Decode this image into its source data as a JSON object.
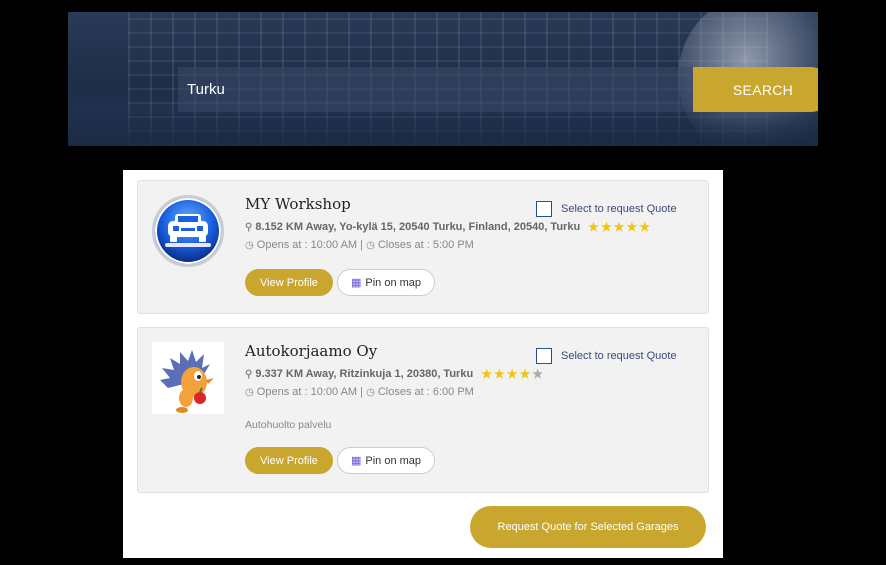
{
  "search": {
    "value": "Turku",
    "button_label": "SEARCH"
  },
  "colors": {
    "accent": "#c9a62e",
    "star": "#f1c40f",
    "map_icon": "#6c4fd6"
  },
  "garages": [
    {
      "name": "MY Workshop",
      "address": "8.152 KM Away, Yo-kylä 15, 20540 Turku, Finland, 20540, Turku",
      "rating": 5,
      "opens": "Opens at : 10:00 AM |",
      "closes": "Closes at : 5:00 PM",
      "description": "",
      "logo_icon": "car-wrench-logo-icon",
      "view_label": "View Profile",
      "map_label": "Pin on map",
      "quote_label": "Select to request Quote"
    },
    {
      "name": "Autokorjaamo Oy",
      "address": "9.337 KM Away, Ritzinkuja 1, 20380, Turku",
      "rating": 4,
      "opens": "Opens at : 10:00 AM |",
      "closes": "Closes at : 6:00 PM",
      "description": "Autohuolto palvelu",
      "logo_icon": "hedgehog-mascot-logo-icon",
      "view_label": "View Profile",
      "map_label": "Pin on map",
      "quote_label": "Select to request Quote"
    }
  ],
  "request_button_label": "Request Quote for Selected Garages"
}
